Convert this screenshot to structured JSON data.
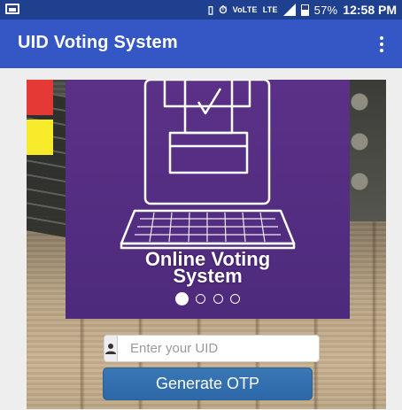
{
  "status_bar": {
    "network_label": "VoLTE",
    "lte_label": "LTE",
    "battery": "57%",
    "time": "12:58 PM"
  },
  "app_bar": {
    "title": "UID Voting System",
    "menu_icon": "more-vert-icon"
  },
  "slider": {
    "title_line1": "Online Voting",
    "title_line2": "System",
    "slide_count": 4,
    "active_slide": 1
  },
  "form": {
    "uid_placeholder": "Enter your UID",
    "uid_value": "",
    "user_icon": "user-icon",
    "generate_button": "Generate OTP"
  },
  "colors": {
    "status_bar": "#1f3f8f",
    "app_bar": "#3557c5",
    "slider_bg": "#5a3187",
    "button": "#3a77b5"
  }
}
